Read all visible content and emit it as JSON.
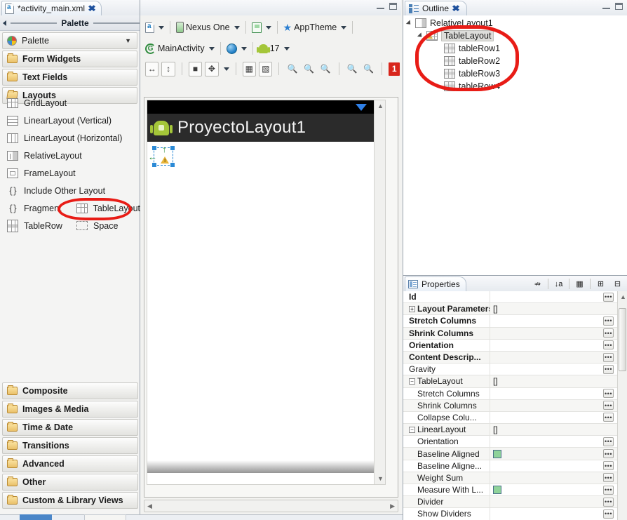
{
  "editor": {
    "tab_label": "*activity_main.xml",
    "tab_icon": "xml-file-icon",
    "close_icon": "close-icon",
    "minimize_icon": "minimize-icon",
    "maximize_icon": "maximize-icon"
  },
  "palette": {
    "header_title": "Palette",
    "drawer_label": "Palette",
    "collapse_icon": "collapse-left-icon",
    "chevron_icon": "chevron-down-icon",
    "top_drawers": [
      {
        "label": "Form Widgets",
        "icon": "folder-icon",
        "open": false
      },
      {
        "label": "Text Fields",
        "icon": "folder-icon",
        "open": false
      },
      {
        "label": "Layouts",
        "icon": "folder-open-icon",
        "open": true
      }
    ],
    "items": [
      {
        "label": "GridLayout",
        "icon": "grid-layout-icon"
      },
      {
        "label": "LinearLayout (Vertical)",
        "icon": "linear-layout-vertical-icon"
      },
      {
        "label": "LinearLayout (Horizontal)",
        "icon": "linear-layout-horizontal-icon"
      },
      {
        "label": "RelativeLayout",
        "icon": "relative-layout-icon"
      },
      {
        "label": "FrameLayout",
        "icon": "frame-layout-icon"
      },
      {
        "label": "Include Other Layout",
        "icon": "include-layout-icon"
      }
    ],
    "pair_row_1": [
      {
        "label": "Fragment",
        "icon": "fragment-icon"
      },
      {
        "label": "TableLayout",
        "icon": "table-layout-icon"
      }
    ],
    "pair_row_2": [
      {
        "label": "TableRow",
        "icon": "table-row-icon"
      },
      {
        "label": "Space",
        "icon": "space-icon"
      }
    ],
    "bottom_drawers": [
      {
        "label": "Composite",
        "icon": "folder-icon"
      },
      {
        "label": "Images & Media",
        "icon": "folder-icon"
      },
      {
        "label": "Time & Date",
        "icon": "folder-icon"
      },
      {
        "label": "Transitions",
        "icon": "folder-icon"
      },
      {
        "label": "Advanced",
        "icon": "folder-icon"
      },
      {
        "label": "Other",
        "icon": "folder-icon"
      },
      {
        "label": "Custom & Library Views",
        "icon": "folder-icon"
      }
    ]
  },
  "toolbar": {
    "row1": {
      "config_icon": "layout-config-icon",
      "device_label": "Nexus One",
      "device_icon": "phone-icon",
      "orientation_icon": "orientation-icon",
      "theme_label": "AppTheme",
      "theme_icon": "theme-star-icon"
    },
    "row2": {
      "activity_label": "MainActivity",
      "activity_icon": "activity-icon",
      "locale_icon": "globe-icon",
      "api_label": "17",
      "api_icon": "android-icon"
    },
    "row3": {
      "fit_width_icon": "fit-width-icon",
      "fit_height_icon": "fit-height-icon",
      "outline_icon": "show-outline-icon",
      "distribute_icon": "distribute-icon",
      "include_icon": "include-in-icon",
      "structure_icon": "structure-icon",
      "zoom_out_fit_icon": "zoom-out-icon",
      "zoom_fit_icon": "zoom-fit-icon",
      "zoom_100_icon": "zoom-100-icon",
      "zoom_minus_icon": "zoom-minus-icon",
      "zoom_plus_icon": "zoom-plus-icon",
      "error_count": "1"
    }
  },
  "preview": {
    "app_title": "ProyectoLayout1",
    "app_icon": "android-robot-icon",
    "wifi_icon": "wifi-icon",
    "battery_icon": "battery-icon",
    "selection_warning_icon": "warning-icon",
    "gravity_arrow_icon": "gravity-arrow-icon"
  },
  "outline": {
    "tab_label": "Outline",
    "tab_icon": "outline-icon",
    "close_icon": "close-icon",
    "minimize_icon": "minimize-icon",
    "maximize_icon": "maximize-icon",
    "tree": [
      {
        "label": "RelativeLayout1",
        "icon": "relative-layout-icon",
        "depth": 0,
        "expanded": true,
        "selected": false,
        "warning": false
      },
      {
        "label": "TableLayout",
        "icon": "table-layout-icon",
        "depth": 1,
        "expanded": true,
        "selected": true,
        "warning": true
      },
      {
        "label": "tableRow1",
        "icon": "table-row-icon",
        "depth": 2,
        "expanded": false,
        "selected": false,
        "warning": false
      },
      {
        "label": "tableRow2",
        "icon": "table-row-icon",
        "depth": 2,
        "expanded": false,
        "selected": false,
        "warning": false
      },
      {
        "label": "tableRow3",
        "icon": "table-row-icon",
        "depth": 2,
        "expanded": false,
        "selected": false,
        "warning": false
      },
      {
        "label": "tableRow4",
        "icon": "table-row-icon",
        "depth": 2,
        "expanded": false,
        "selected": false,
        "warning": false
      }
    ]
  },
  "annotation": {
    "color": "#e81c16",
    "shape": "ellipse-highlight"
  },
  "properties": {
    "tab_label": "Properties",
    "tab_icon": "properties-icon",
    "tools": [
      {
        "icon": "show-advanced-icon"
      },
      {
        "icon": "sort-alphabetical-icon"
      },
      {
        "icon": "restore-default-icon"
      },
      {
        "icon": "expand-all-icon"
      },
      {
        "icon": "collapse-all-icon"
      }
    ],
    "rows": [
      {
        "name": "Id",
        "value": "",
        "bold": true,
        "indent": 0,
        "expander": "",
        "button": true,
        "checkbox": false
      },
      {
        "name": "Layout Parameters",
        "value": "[]",
        "bold": true,
        "indent": 0,
        "expander": "plus",
        "button": false,
        "checkbox": false
      },
      {
        "name": "Stretch Columns",
        "value": "",
        "bold": true,
        "indent": 0,
        "expander": "",
        "button": true,
        "checkbox": false
      },
      {
        "name": "Shrink Columns",
        "value": "",
        "bold": true,
        "indent": 0,
        "expander": "",
        "button": true,
        "checkbox": false
      },
      {
        "name": "Orientation",
        "value": "",
        "bold": true,
        "indent": 0,
        "expander": "",
        "button": true,
        "checkbox": false
      },
      {
        "name": "Content Descrip...",
        "value": "",
        "bold": true,
        "indent": 0,
        "expander": "",
        "button": true,
        "checkbox": false
      },
      {
        "name": "Gravity",
        "value": "",
        "bold": false,
        "indent": 0,
        "expander": "",
        "button": true,
        "checkbox": false
      },
      {
        "name": "TableLayout",
        "value": "[]",
        "bold": false,
        "indent": 0,
        "expander": "minus",
        "button": false,
        "checkbox": false
      },
      {
        "name": "Stretch Columns",
        "value": "",
        "bold": false,
        "indent": 1,
        "expander": "",
        "button": true,
        "checkbox": false
      },
      {
        "name": "Shrink Columns",
        "value": "",
        "bold": false,
        "indent": 1,
        "expander": "",
        "button": true,
        "checkbox": false
      },
      {
        "name": "Collapse Colu...",
        "value": "",
        "bold": false,
        "indent": 1,
        "expander": "",
        "button": true,
        "checkbox": false
      },
      {
        "name": "LinearLayout",
        "value": "[]",
        "bold": false,
        "indent": 0,
        "expander": "minus",
        "button": false,
        "checkbox": false
      },
      {
        "name": "Orientation",
        "value": "",
        "bold": false,
        "indent": 1,
        "expander": "",
        "button": true,
        "checkbox": false
      },
      {
        "name": "Baseline Aligned",
        "value": "",
        "bold": false,
        "indent": 1,
        "expander": "",
        "button": true,
        "checkbox": true
      },
      {
        "name": "Baseline Aligne...",
        "value": "",
        "bold": false,
        "indent": 1,
        "expander": "",
        "button": true,
        "checkbox": false
      },
      {
        "name": "Weight Sum",
        "value": "",
        "bold": false,
        "indent": 1,
        "expander": "",
        "button": true,
        "checkbox": false
      },
      {
        "name": "Measure With L...",
        "value": "",
        "bold": false,
        "indent": 1,
        "expander": "",
        "button": true,
        "checkbox": true
      },
      {
        "name": "Divider",
        "value": "",
        "bold": false,
        "indent": 1,
        "expander": "",
        "button": true,
        "checkbox": false
      },
      {
        "name": "Show Dividers",
        "value": "",
        "bold": false,
        "indent": 1,
        "expander": "",
        "button": true,
        "checkbox": false
      }
    ]
  }
}
